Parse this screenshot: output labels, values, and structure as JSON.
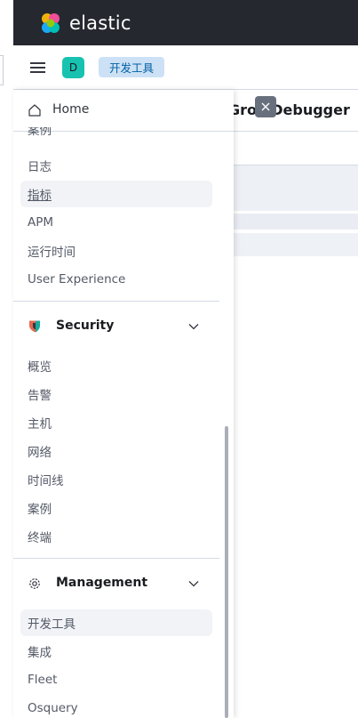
{
  "header": {
    "brand": "elastic",
    "avatar_initial": "D",
    "breadcrumb": "开发工具"
  },
  "background_page": {
    "title": "Grok Debugger"
  },
  "nav": {
    "home_label": "Home",
    "partial_item": "案例",
    "observability_items": [
      "日志",
      "指标",
      "APM",
      "运行时间",
      "User Experience"
    ],
    "security": {
      "label": "Security",
      "items": [
        "概览",
        "告警",
        "主机",
        "网络",
        "时间线",
        "案例",
        "终端"
      ]
    },
    "management": {
      "label": "Management",
      "items": [
        "开发工具",
        "集成",
        "Fleet",
        "Osquery"
      ]
    }
  },
  "colors": {
    "header_bg": "#25282f",
    "avatar_bg": "#17c3b0",
    "breadcrumb_bg": "#cce1f5",
    "breadcrumb_text": "#0061a6",
    "active_item_bg": "#f1f3f7",
    "security_red": "#e7664c",
    "security_teal": "#1ba9a0"
  }
}
